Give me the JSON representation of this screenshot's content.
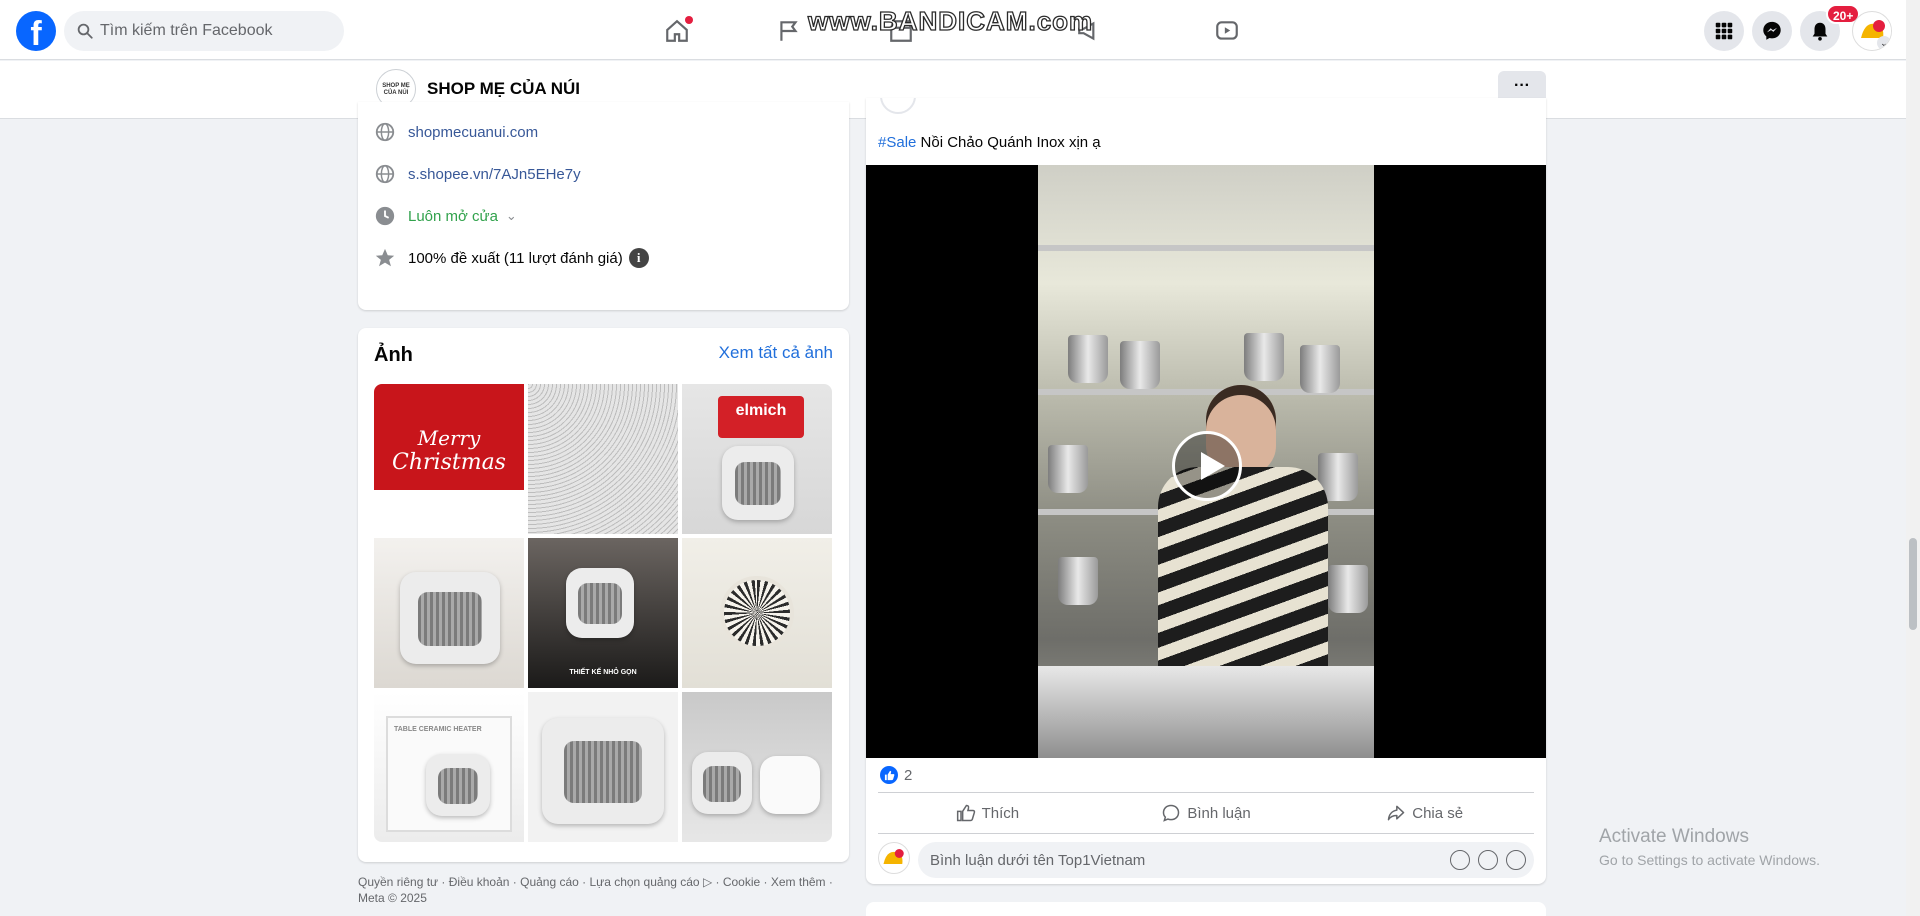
{
  "topnav": {
    "search_placeholder": "Tìm kiếm trên Facebook",
    "watermark": "www.BANDICAM.com",
    "notification_badge": "20+"
  },
  "page": {
    "avatar_text": "SHOP MẸ CỦA NÚI",
    "name": "SHOP MẸ CỦA NÚI",
    "more_label": "···"
  },
  "intro": {
    "website": "shopmecuanui.com",
    "shopee": "s.shopee.vn/7AJn5EHe7y",
    "hours": "Luôn mở cửa",
    "rating": "100% đề xuất (11 lượt đánh giá)"
  },
  "photos": {
    "title": "Ảnh",
    "see_all": "Xem tất cả ảnh",
    "ph1_line1": "Merry",
    "ph1_line2": "Christmas",
    "ph3_sign": "elmich",
    "ph5_caption": "THIẾT KẾ NHỎ GỌN",
    "ph7_caption": "TABLE CERAMIC HEATER"
  },
  "footer": {
    "text": "Quyền riêng tư · Điều khoản · Quảng cáo · Lựa chọn quảng cáo ▷ · Cookie · Xem thêm · Meta © 2025"
  },
  "post": {
    "hashtag": "#Sale",
    "text": " Nồi Chảo Quánh Inox xịn ạ",
    "like_count": "2",
    "actions": {
      "like": "Thích",
      "comment": "Bình luận",
      "share": "Chia sẻ"
    },
    "comment_placeholder": "Bình luận dưới tên Top1Vietnam"
  },
  "system": {
    "activate_title": "Activate Windows",
    "activate_sub": "Go to Settings to activate Windows."
  },
  "colors": {
    "brand": "#0866ff",
    "link": "#385898",
    "accent_link": "#216fdb",
    "open_status": "#31a24c",
    "badge": "#e41e3f"
  }
}
